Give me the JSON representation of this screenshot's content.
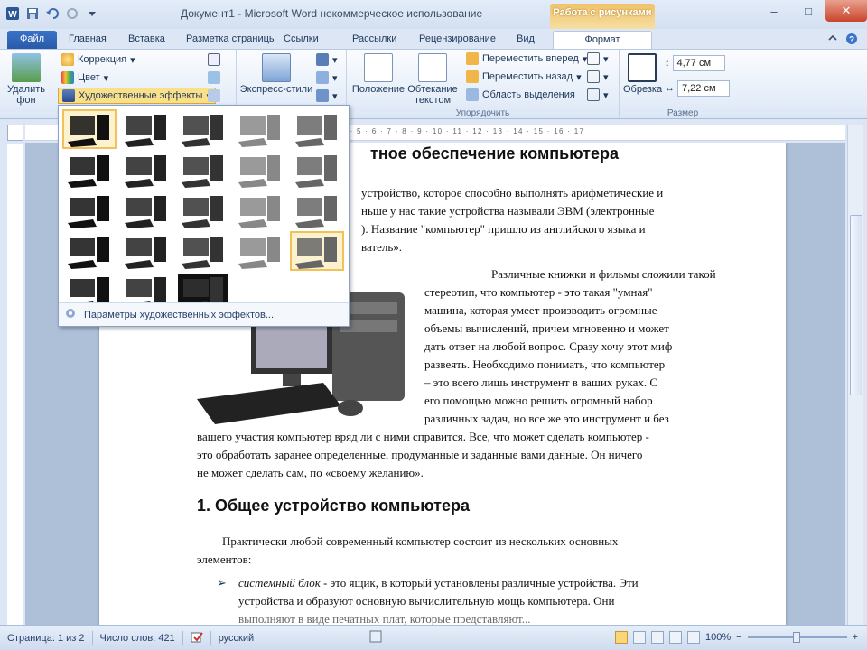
{
  "window": {
    "title": "Документ1 - Microsoft Word некоммерческое использование",
    "context_tab_header": "Работа с рисунками",
    "minimize": "–",
    "maximize": "□",
    "close": "✕"
  },
  "tabs": {
    "file": "Файл",
    "home": "Главная",
    "insert": "Вставка",
    "layout": "Разметка страницы",
    "references": "Ссылки",
    "mailings": "Рассылки",
    "review": "Рецензирование",
    "view": "Вид",
    "format": "Формат"
  },
  "ribbon": {
    "remove_bg": "Удалить фон",
    "correction": "Коррекция",
    "color": "Цвет",
    "artistic_effects": "Художественные эффекты",
    "express_styles": "Экспресс-стили",
    "position": "Положение",
    "wrap_text": "Обтекание текстом",
    "bring_forward": "Переместить вперед",
    "send_backward": "Переместить назад",
    "selection_pane": "Область выделения",
    "arrange_group": "Упорядочить",
    "crop": "Обрезка",
    "height_value": "4,77 см",
    "width_value": "7,22 см",
    "size_group": "Размер"
  },
  "gallery": {
    "footer": "Параметры художественных эффектов...",
    "selected_index": 0,
    "hover_index": 19,
    "cell_count": 23
  },
  "ruler": {
    "marks": "1 · 2 · 3 · 4 · 5 · 6 · 7 · 8 · 9 · 10 · 11 · 12 · 13 · 14 · 15 · 16 · 17"
  },
  "document": {
    "title_fragment": "тное обеспечение компьютера",
    "intro_lines": [
      "устройство, которое способно выполнять арифметические и",
      "ньше у нас   такие устройства называли ЭВМ (электронные",
      "). Название \"компьютер\" пришло из английского языка и",
      "ватель»."
    ],
    "para2_lines": [
      "Различные книжки и фильмы сложили такой",
      "стереотип, что компьютер - это такая \"умная\"",
      "машина, которая умеет производить огромные",
      "объемы вычислений, причем мгновенно и может",
      "дать ответ на любой вопрос. Сразу хочу этот миф",
      "развеять. Необходимо понимать, что компьютер",
      "– это всего лишь инструмент в ваших руках. С",
      "его помощью можно решить огромный набор",
      "различных задач, но все же это инструмент и без"
    ],
    "para2_full_lines": [
      "вашего участия компьютер вряд ли с ними справится. Все, что может сделать компьютер -",
      "это обработать заранее определенные, продуманные и заданные вами данные. Он ничего",
      "не может сделать сам, по «своему желанию»."
    ],
    "heading1": "1. Общее устройство компьютера",
    "para3_lines": [
      "Практически любой современный компьютер состоит из нескольких основных",
      "элементов:"
    ],
    "bullet_term": "системный блок",
    "bullet_lines": [
      " - это ящик, в который установлены различные устройства. Эти",
      "устройства и образуют основную вычислительную мощь компьютера. Они",
      "выполняют в виде печатных плат, которые представляют..."
    ]
  },
  "status": {
    "page": "Страница: 1 из 2",
    "words": "Число слов: 421",
    "lang": "русский",
    "zoom": "100%",
    "zoom_minus": "−",
    "zoom_plus": "+"
  }
}
